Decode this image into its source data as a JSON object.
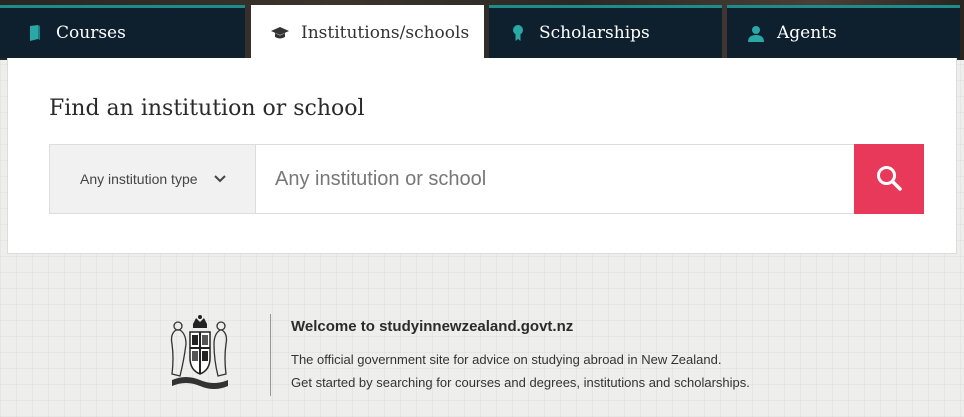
{
  "tabs": [
    {
      "label": "Courses",
      "icon": "book-icon"
    },
    {
      "label": "Institutions/schools",
      "icon": "graduation-cap-icon"
    },
    {
      "label": "Scholarships",
      "icon": "award-ribbon-icon"
    },
    {
      "label": "Agents",
      "icon": "person-icon"
    }
  ],
  "search": {
    "title": "Find an institution or school",
    "type_label": "Any institution type",
    "placeholder": "Any institution or school",
    "value": ""
  },
  "colors": {
    "tab_bg": "#0e1f2e",
    "tab_accent": "#1f8c8c",
    "search_button": "#e8395a"
  },
  "welcome": {
    "title": "Welcome to studyinnewzealand.govt.nz",
    "line1": "The official government site for advice on studying abroad in New Zealand.",
    "line2": "Get started by searching for courses and degrees, institutions and scholarships."
  }
}
